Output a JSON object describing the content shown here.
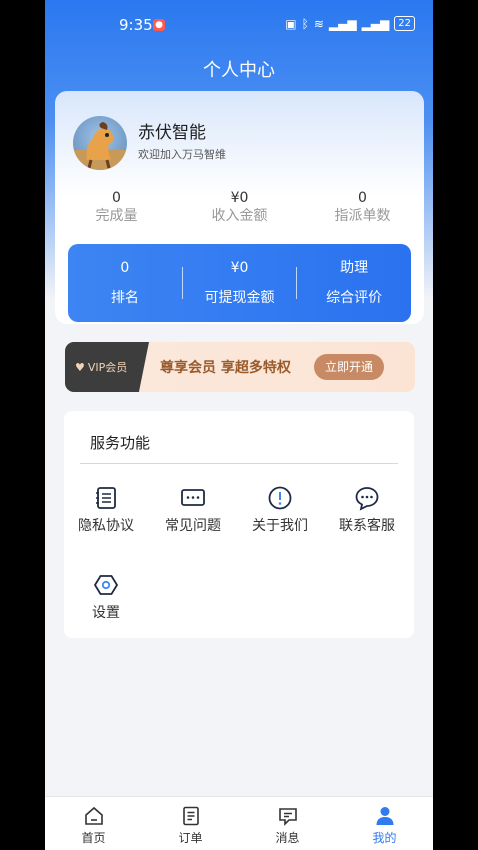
{
  "status": {
    "time": "9:35",
    "battery": "22"
  },
  "page_title": "个人中心",
  "profile": {
    "name": "赤伏智能",
    "welcome": "欢迎加入万马智维",
    "stats": [
      {
        "value": "0",
        "label": "完成量"
      },
      {
        "value": "¥0",
        "label": "收入金额"
      },
      {
        "value": "0",
        "label": "指派单数"
      }
    ],
    "panel": [
      {
        "value": "0",
        "label": "排名"
      },
      {
        "value": "¥0",
        "label": "可提现金额"
      },
      {
        "value": "助理",
        "label": "综合评价"
      }
    ]
  },
  "vip": {
    "tag": "VIP会员",
    "text": "尊享会员 享超多特权",
    "button": "立即开通"
  },
  "services": {
    "title": "服务功能",
    "items": [
      {
        "label": "隐私协议",
        "icon": "document-list-icon"
      },
      {
        "label": "常见问题",
        "icon": "chat-dots-icon"
      },
      {
        "label": "关于我们",
        "icon": "info-circle-icon"
      },
      {
        "label": "联系客服",
        "icon": "message-bubble-icon"
      },
      {
        "label": "设置",
        "icon": "hexagon-settings-icon"
      }
    ]
  },
  "tabs": [
    {
      "label": "首页",
      "icon": "home-icon"
    },
    {
      "label": "订单",
      "icon": "order-list-icon"
    },
    {
      "label": "消息",
      "icon": "message-icon"
    },
    {
      "label": "我的",
      "icon": "person-icon",
      "active": true
    }
  ],
  "colors": {
    "primary": "#2f7bf0",
    "vip_button": "#c78a64",
    "vip_text": "#9a5b2c"
  }
}
